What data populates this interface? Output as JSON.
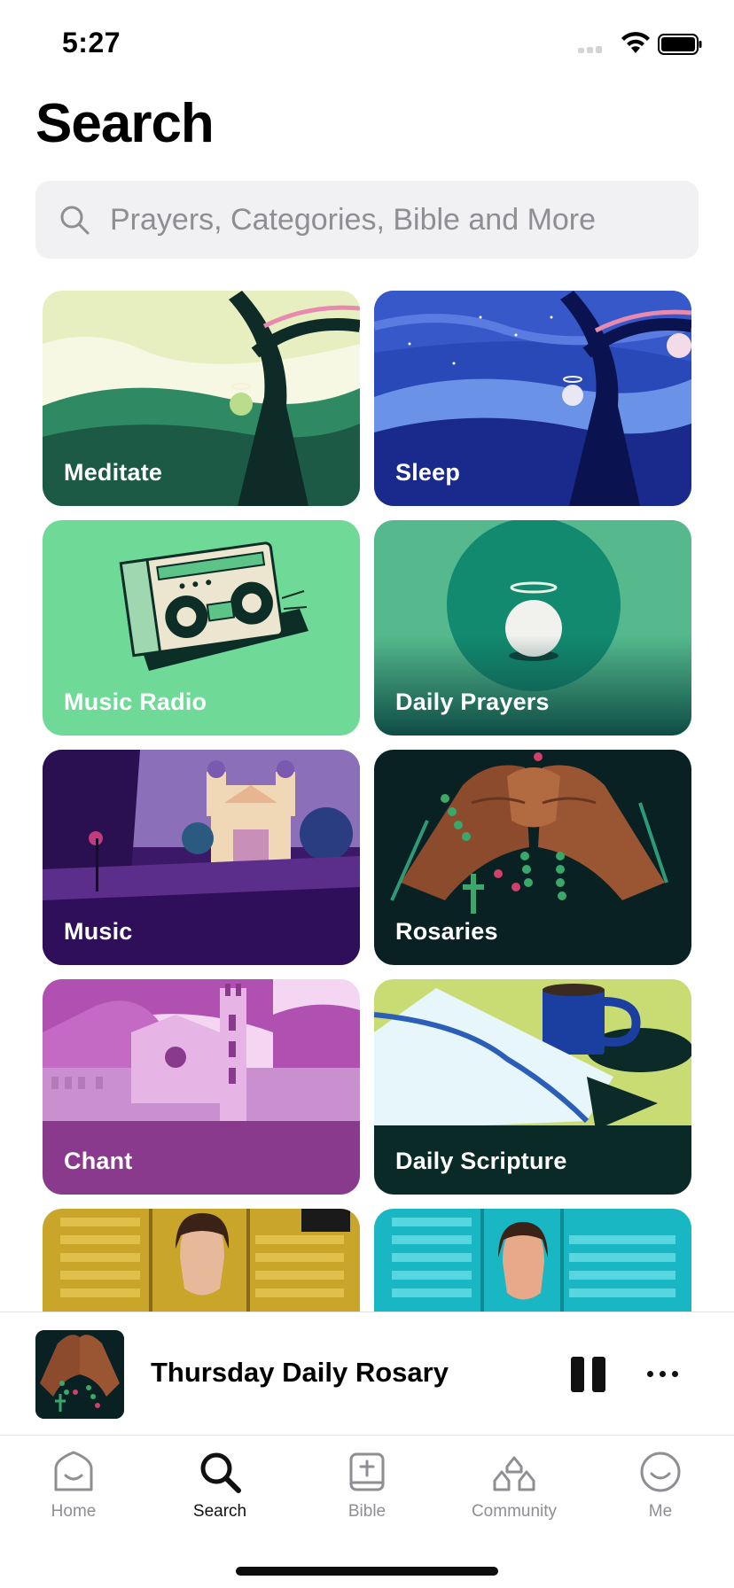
{
  "status": {
    "time": "5:27"
  },
  "header": {
    "title": "Search"
  },
  "search": {
    "placeholder": "Prayers, Categories, Bible and More"
  },
  "categories": [
    {
      "label": "Meditate",
      "bg": "#1f5a48"
    },
    {
      "label": "Sleep",
      "bg": "#17237a"
    },
    {
      "label": "Music Radio",
      "bg": "#6fda98"
    },
    {
      "label": "Daily Prayers",
      "bg": "#0e4c45"
    },
    {
      "label": "Music",
      "bg": "#3a1462"
    },
    {
      "label": "Rosaries",
      "bg": "#0a2124"
    },
    {
      "label": "Chant",
      "bg": "#8a3a8c"
    },
    {
      "label": "Daily Scripture",
      "bg": "#0a2a28"
    },
    {
      "label": "",
      "bg": "#c9a52a"
    },
    {
      "label": "",
      "bg": "#19b6c4"
    }
  ],
  "now_playing": {
    "title": "Thursday Daily Rosary"
  },
  "tabs": [
    {
      "label": "Home",
      "icon": "home-icon"
    },
    {
      "label": "Search",
      "icon": "search-icon",
      "active": true
    },
    {
      "label": "Bible",
      "icon": "bible-icon"
    },
    {
      "label": "Community",
      "icon": "community-icon"
    },
    {
      "label": "Me",
      "icon": "smiley-icon"
    }
  ]
}
